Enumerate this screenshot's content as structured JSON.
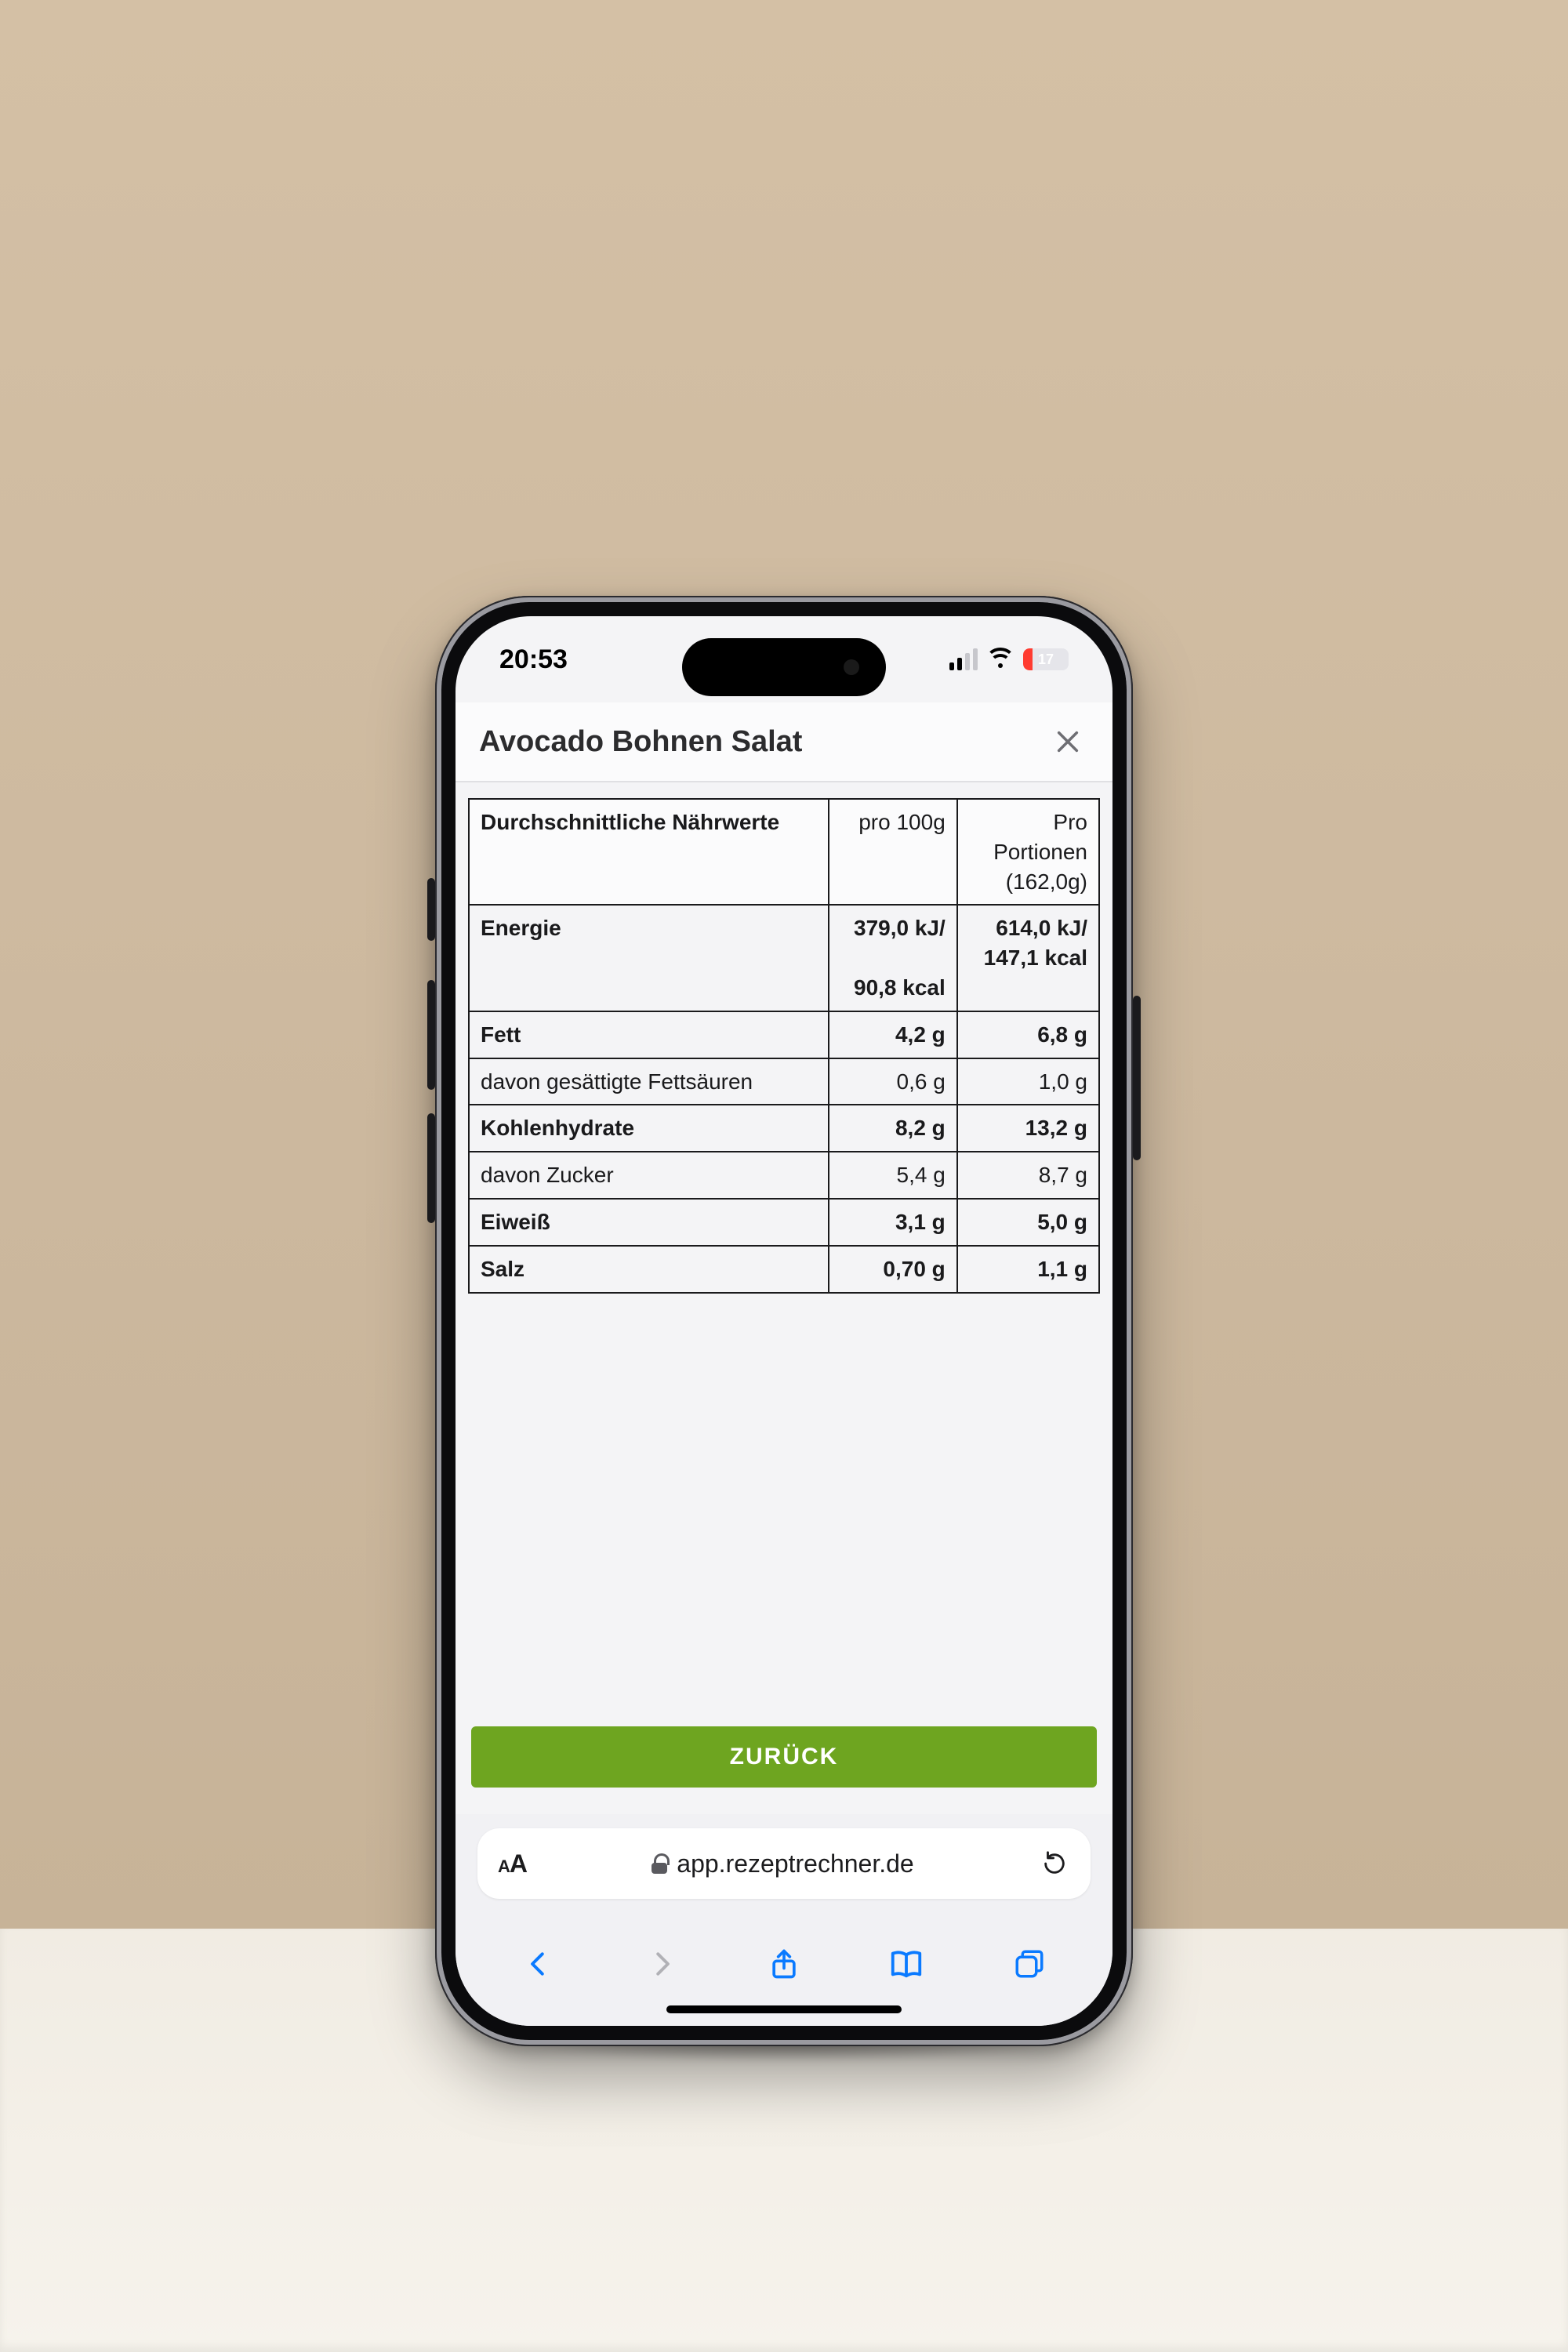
{
  "statusbar": {
    "time": "20:53",
    "battery_pct": "17"
  },
  "app": {
    "title": "Avocado Bohnen Salat"
  },
  "table": {
    "header": {
      "label": "Durchschnittliche Nährwerte",
      "col1": "pro 100g",
      "col2": "Pro\nPortionen\n(162,0g)"
    },
    "rows": [
      {
        "label": "Energie",
        "bold": true,
        "v1": "379,0 kJ/\n\n90,8 kcal",
        "v2": "614,0 kJ/\n147,1 kcal"
      },
      {
        "label": "Fett",
        "bold": true,
        "v1": "4,2 g",
        "v2": "6,8 g"
      },
      {
        "label": "davon gesättigte Fettsäuren",
        "bold": false,
        "v1": "0,6 g",
        "v2": "1,0 g"
      },
      {
        "label": "Kohlenhydrate",
        "bold": true,
        "v1": "8,2 g",
        "v2": "13,2 g"
      },
      {
        "label": "davon Zucker",
        "bold": false,
        "v1": "5,4 g",
        "v2": "8,7 g"
      },
      {
        "label": "Eiweiß",
        "bold": true,
        "v1": "3,1 g",
        "v2": "5,0 g"
      },
      {
        "label": "Salz",
        "bold": true,
        "v1": "0,70 g",
        "v2": "1,1 g"
      }
    ]
  },
  "buttons": {
    "back": "ZURÜCK"
  },
  "safari": {
    "aa": "AA",
    "url": "app.rezeptrechner.de"
  }
}
